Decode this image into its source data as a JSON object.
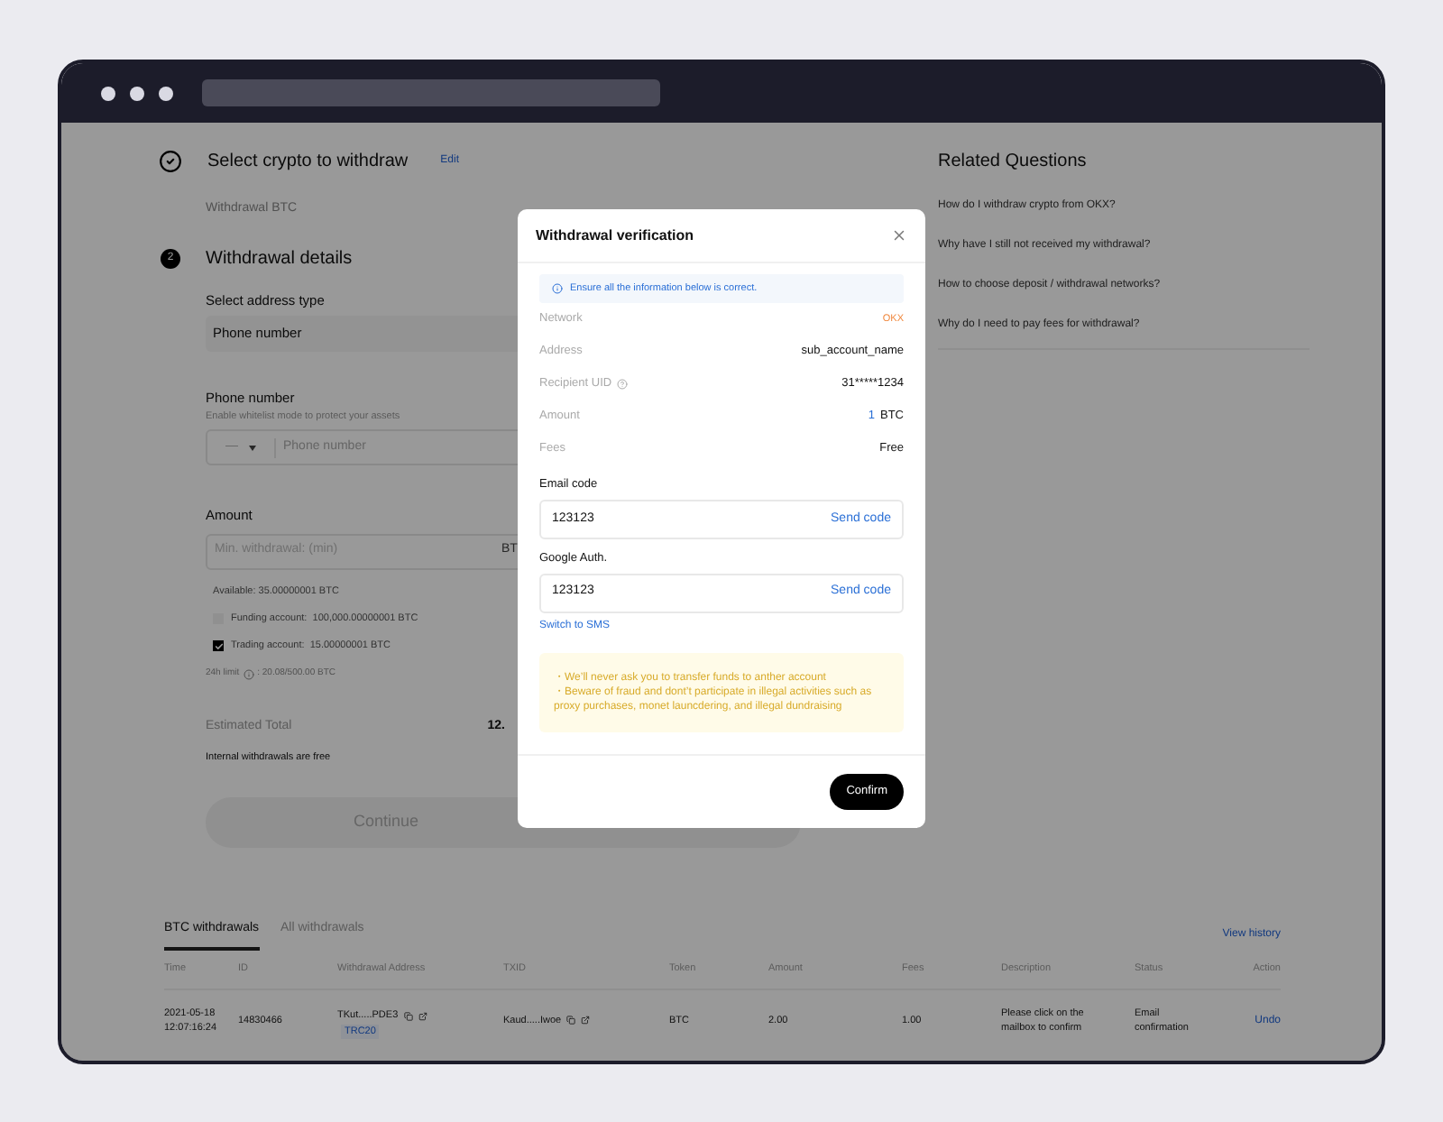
{
  "steps": [
    {
      "completed": true,
      "title": "Select crypto to withdraw",
      "action": "Edit",
      "summary": "Withdrawal BTC"
    },
    {
      "completed": false,
      "number": "2",
      "title": "Withdrawal details"
    }
  ],
  "form": {
    "address_type": {
      "label": "Select address type",
      "value": "Phone number"
    },
    "phone": {
      "label": "Phone number",
      "hint": "Enable whitelist mode to protect your assets",
      "country": "—",
      "placeholder": "Phone number"
    },
    "amount": {
      "label": "Amount",
      "placeholder": "Min. withdrawal: (min)",
      "unit": "BT"
    },
    "available": "Available:  35.00000001 BTC",
    "accounts": [
      {
        "label": "Funding account:",
        "value": "100,000.00000001 BTC",
        "checked": false
      },
      {
        "label": "Trading account:",
        "value": "15.00000001 BTC",
        "checked": true
      }
    ],
    "limit_label": "24h limit",
    "limit_value": ": 20.08/500.00 BTC",
    "total_label": "Estimated Total",
    "total_value": "12.",
    "note": "Internal withdrawals are free",
    "continue": {
      "label": "Continue",
      "disabled": true
    }
  },
  "related": {
    "title": "Related Questions",
    "questions": [
      "How do I withdraw crypto from OKX?",
      "Why have I still not received my withdrawal?",
      "How to choose deposit / withdrawal networks?",
      "Why do I need to pay fees for withdrawal?"
    ]
  },
  "history": {
    "tabs": [
      {
        "label": "BTC withdrawals",
        "selected": true
      },
      {
        "label": "All withdrawals",
        "selected": false
      }
    ],
    "link": "View history",
    "columns": [
      "Time",
      "ID",
      "Withdrawal Address",
      "TXID",
      "Token",
      "Amount",
      "Fees",
      "Description",
      "Status",
      "Action"
    ],
    "rows": [
      {
        "time": [
          "2021-05-18",
          "12:07:16:24"
        ],
        "id": "14830466",
        "address": "TKut.....PDE3",
        "network": "TRC20",
        "txid": "Kaud.....Iwoe",
        "token": "BTC",
        "amount": "2.00",
        "fees": "1.00",
        "description": "Please click on the mailbox to confirm",
        "status": "Email confirmation",
        "action": "Undo"
      }
    ]
  },
  "modal": {
    "title": "Withdrawal verification",
    "notice": "Ensure all the information below is correct.",
    "details": [
      {
        "kind": "highlight",
        "label": "Network",
        "value": "OKX"
      },
      {
        "kind": "plain",
        "label": "Address",
        "value": "sub_account_name"
      },
      {
        "kind": "help",
        "label": "Recipient UID",
        "value": "31*****1234"
      },
      {
        "kind": "amount",
        "label": "Amount",
        "number": "1",
        "value": "BTC"
      },
      {
        "kind": "plain",
        "label": "Fees",
        "value": "Free"
      }
    ],
    "codes": [
      {
        "label": "Email code",
        "value": "123123",
        "action": "Send code"
      },
      {
        "label": "Google Auth.",
        "value": "123123",
        "action": "Send code"
      }
    ],
    "switch_link": "Switch to SMS",
    "warnings": [
      "・We’ll never ask you to transfer funds to anther account",
      "・Beware of fraud and dont’t participate in illegal activities such as proxy purchases, monet launcdering, and illegal dundraising"
    ],
    "confirm": "Confirm"
  }
}
